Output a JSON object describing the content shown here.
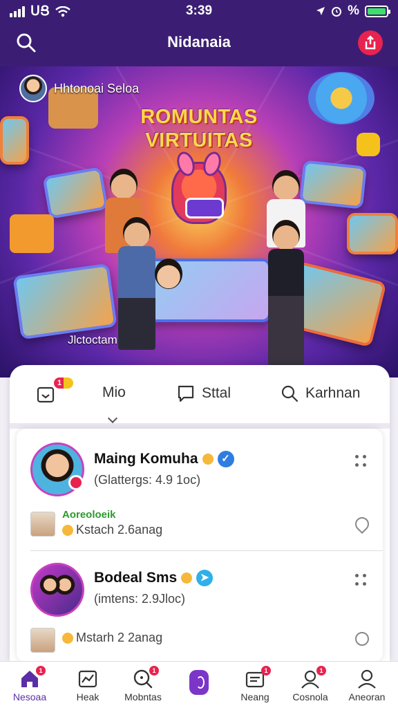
{
  "status_bar": {
    "carrier": "ՍՑ",
    "time": "3:39",
    "right_text": "%",
    "icons": [
      "signal-bars-icon",
      "wifi-icon",
      "location-arrow-icon",
      "battery-icon"
    ]
  },
  "header": {
    "title": "Nidanaia",
    "search_icon": "search-icon",
    "action_icon": "share-icon",
    "accent_color": "#e8234f",
    "background_color": "#3b1e73"
  },
  "hero": {
    "user_name": "Hhtonoai Seloa",
    "title_line1": "ROMUNTAS",
    "title_line2": "VIRTUITAS",
    "bottom_caption": "Jlctoctam"
  },
  "tabs": [
    {
      "label": "",
      "icon": "calendar-icon",
      "badge": "1"
    },
    {
      "label": "Mio",
      "icon": "",
      "badge": ""
    },
    {
      "label": "Sttal",
      "icon": "message-icon",
      "badge": ""
    },
    {
      "label": "Karhnan",
      "icon": "search-icon",
      "badge": ""
    }
  ],
  "feed": {
    "posts": [
      {
        "name": "Maing Komuha",
        "meta": "(Glattergs: 4.9 1oc)",
        "sub_label": "Aoreoloeik",
        "sub_text": "Kstach 2.6anag"
      },
      {
        "name": "Bodeal Sms",
        "meta": "(imtens: 2.9Jloc)",
        "sub_label": "",
        "sub_text": "Mstarh 2 2anag"
      }
    ]
  },
  "bottom_nav": [
    {
      "label": "Nesoaa",
      "icon": "home-icon",
      "badge": "1"
    },
    {
      "label": "Heak",
      "icon": "chart-icon",
      "badge": ""
    },
    {
      "label": "Mobntas",
      "icon": "search-icon",
      "badge": "1"
    },
    {
      "label": "",
      "icon": "center-action-icon",
      "badge": ""
    },
    {
      "label": "Neang",
      "icon": "mail-icon",
      "badge": "1"
    },
    {
      "label": "Cosnola",
      "icon": "users-icon",
      "badge": "1"
    },
    {
      "label": "Aneoran",
      "icon": "profile-icon",
      "badge": ""
    }
  ]
}
